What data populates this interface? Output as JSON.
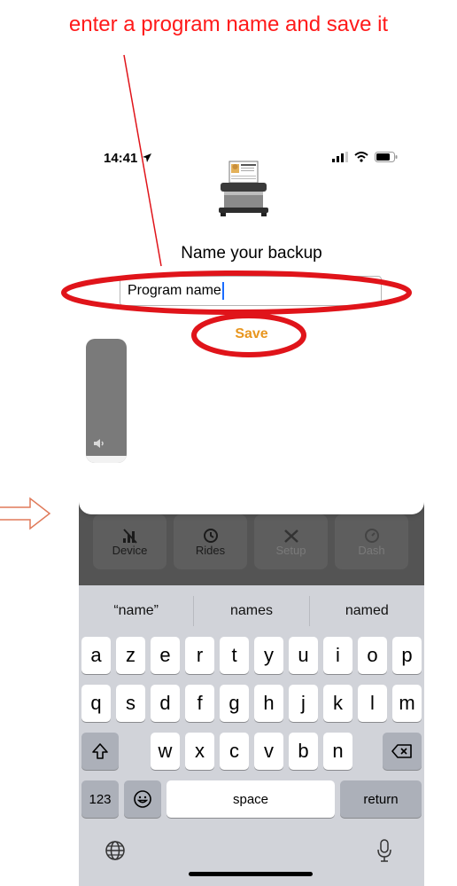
{
  "instruction": "enter a program name and save it",
  "status": {
    "time": "14:41"
  },
  "dialog": {
    "title": "Name your backup",
    "input_value": "Program name",
    "save_label": "Save"
  },
  "tabs": [
    {
      "label": "Device",
      "icon": "no-signal-icon"
    },
    {
      "label": "Rides",
      "icon": "history-icon"
    },
    {
      "label": "Setup",
      "icon": "tools-icon"
    },
    {
      "label": "Dash",
      "icon": "gauge-icon"
    }
  ],
  "keyboard": {
    "suggestions": [
      "“name”",
      "names",
      "named"
    ],
    "row1": [
      "a",
      "z",
      "e",
      "r",
      "t",
      "y",
      "u",
      "i",
      "o",
      "p"
    ],
    "row2": [
      "q",
      "s",
      "d",
      "f",
      "g",
      "h",
      "j",
      "k",
      "l",
      "m"
    ],
    "row3": [
      "w",
      "x",
      "c",
      "v",
      "b",
      "n"
    ],
    "numbers_label": "123",
    "space_label": "space",
    "return_label": "return"
  },
  "colors": {
    "annotation": "#ff1a1a",
    "save": "#e8961f",
    "cursor": "#1a6cff"
  }
}
